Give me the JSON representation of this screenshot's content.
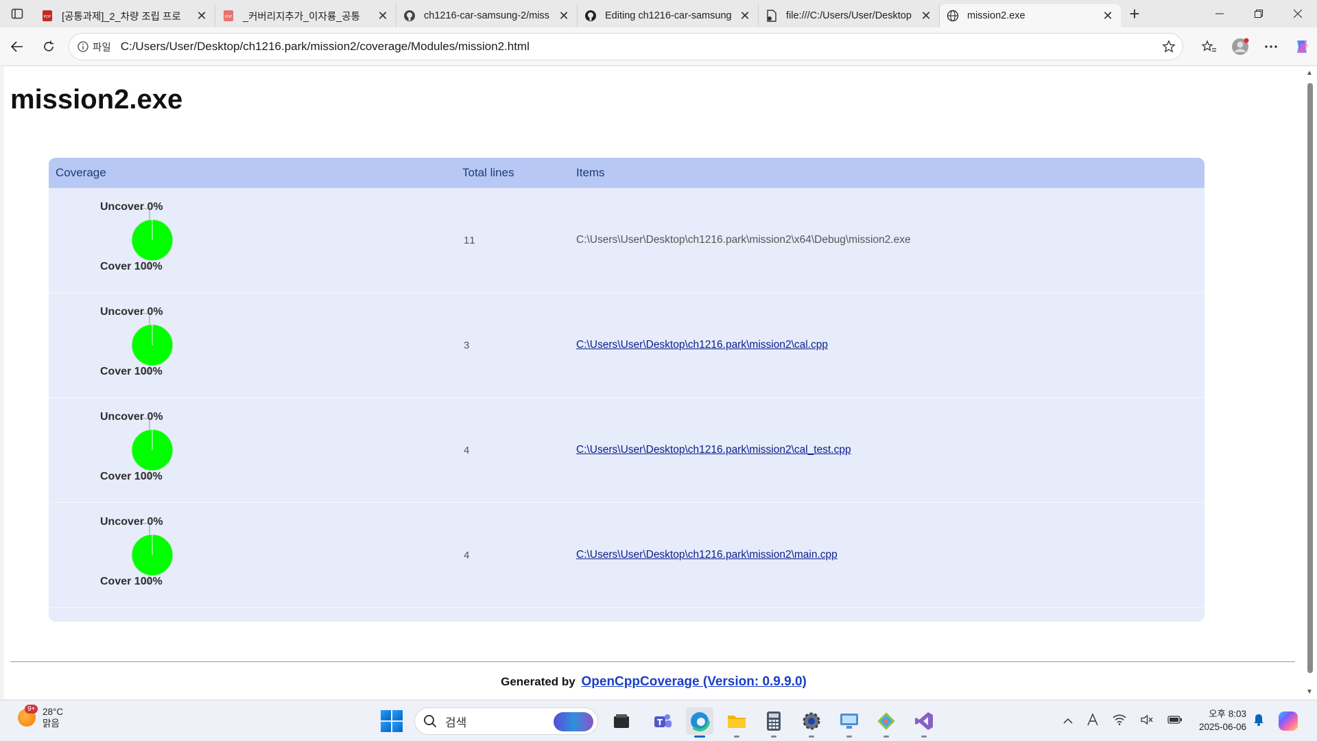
{
  "browser": {
    "tabs": [
      {
        "title": "[공통과제]_2_차량 조립 프로",
        "icon": "pdf-icon",
        "active": false
      },
      {
        "title": "_커버리지추가_이자룡_공통",
        "icon": "pdf-icon",
        "active": false
      },
      {
        "title": "ch1216-car-samsung-2/miss",
        "icon": "github-icon",
        "active": false
      },
      {
        "title": "Editing ch1216-car-samsung",
        "icon": "github-icon",
        "active": false
      },
      {
        "title": "file:///C:/Users/User/Desktop",
        "icon": "file-icon",
        "active": false
      },
      {
        "title": "mission2.exe",
        "icon": "globe-icon",
        "active": true
      }
    ],
    "address": {
      "info_label": "파일",
      "url": "C:/Users/User/Desktop/ch1216.park/mission2/coverage/Modules/mission2.html"
    }
  },
  "page": {
    "title": "mission2.exe",
    "table": {
      "headers": {
        "coverage": "Coverage",
        "total_lines": "Total lines",
        "items": "Items"
      },
      "rows": [
        {
          "uncover_label": "Uncover 0%",
          "cover_label": "Cover 100%",
          "cover_fraction": 1.0,
          "total_lines": "11",
          "item": "C:\\Users\\User\\Desktop\\ch1216.park\\mission2\\x64\\Debug\\mission2.exe",
          "is_link": false
        },
        {
          "uncover_label": "Uncover 0%",
          "cover_label": "Cover 100%",
          "cover_fraction": 1.0,
          "total_lines": "3",
          "item": "C:\\Users\\User\\Desktop\\ch1216.park\\mission2\\cal.cpp",
          "is_link": true
        },
        {
          "uncover_label": "Uncover 0%",
          "cover_label": "Cover 100%",
          "cover_fraction": 1.0,
          "total_lines": "4",
          "item": "C:\\Users\\User\\Desktop\\ch1216.park\\mission2\\cal_test.cpp",
          "is_link": true
        },
        {
          "uncover_label": "Uncover 0%",
          "cover_label": "Cover 100%",
          "cover_fraction": 1.0,
          "total_lines": "4",
          "item": "C:\\Users\\User\\Desktop\\ch1216.park\\mission2\\main.cpp",
          "is_link": true
        }
      ]
    },
    "footer": {
      "prefix": "Generated by",
      "link": "OpenCppCoverage (Version: 0.9.9.0)"
    },
    "colors": {
      "cover": "#00ff00",
      "header_bg": "#b7c8f5",
      "table_bg": "#e7ecfb"
    }
  },
  "taskbar": {
    "weather": {
      "badge": "9+",
      "temp": "28°C",
      "condition": "맑음"
    },
    "search_placeholder": "검색",
    "apps": [
      "file-explorer-app-icon",
      "teams-icon",
      "edge-icon",
      "folder-icon",
      "calculator-icon",
      "settings-icon",
      "remote-desktop-icon",
      "git-icon",
      "visual-studio-icon"
    ],
    "clock": {
      "time": "오후 8:03",
      "date": "2025-06-06"
    }
  }
}
